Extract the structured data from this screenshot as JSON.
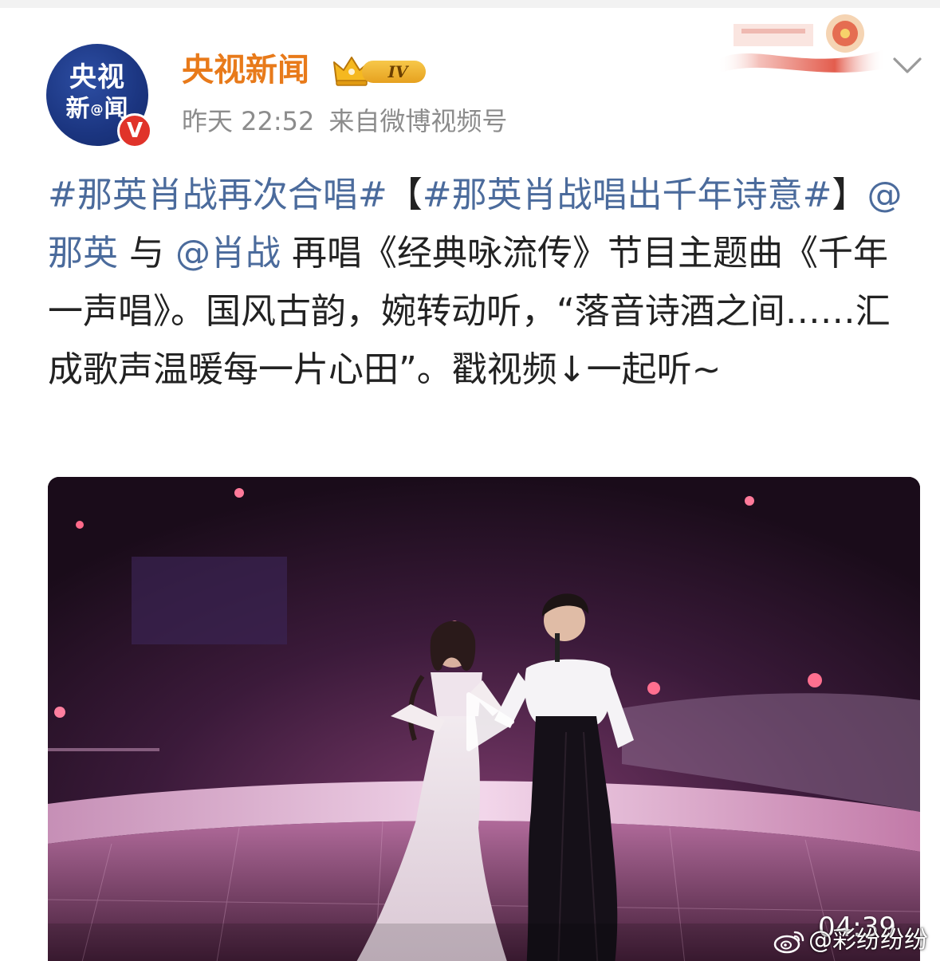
{
  "header": {
    "account_name": "央视新闻",
    "avatar_line1": "央视",
    "avatar_line2_a": "新",
    "avatar_line2_at": "@",
    "avatar_line2_b": "闻",
    "verified_mark": "V",
    "vip_level": "IV",
    "time": "昨天 22:52",
    "source": "来自微博视频号"
  },
  "post": {
    "segments": [
      {
        "text": "#那英肖战再次合唱#",
        "kind": "topic"
      },
      {
        "text": "【",
        "kind": "plain"
      },
      {
        "text": "#那英肖战唱出千年诗意#",
        "kind": "topic"
      },
      {
        "text": "】",
        "kind": "plain"
      },
      {
        "text": "@那英",
        "kind": "mention"
      },
      {
        "text": " 与 ",
        "kind": "plain"
      },
      {
        "text": "@肖战",
        "kind": "mention"
      },
      {
        "text": " 再唱《经典咏流传》节目主题曲《千年一声唱》。国风古韵，婉转动听，“落音诗酒之间……汇成歌声温暖每一片心田”。戳视频↓一起听~",
        "kind": "plain"
      }
    ]
  },
  "video": {
    "duration": "04:39"
  },
  "watermark": {
    "text": "@彩纷纷纷"
  },
  "icons": {
    "dropdown": "chevron-down-icon",
    "play": "play-icon",
    "watermark_logo": "weibo-logo-icon",
    "vip": "crown-icon"
  },
  "colors": {
    "account_name": "#e87a1a",
    "link": "#4b6b9c",
    "body_text": "#222222",
    "meta_text": "#8c8c8c",
    "verified": "#e0332a",
    "avatar_bg": "#1b3580"
  }
}
